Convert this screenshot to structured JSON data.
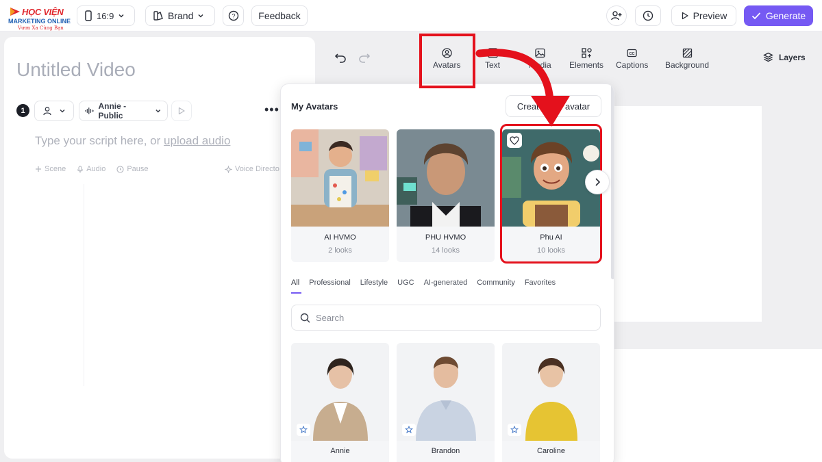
{
  "brand": {
    "line1": "HỌC VIỆN",
    "line2": "MARKETING ONLINE",
    "line3": "Vươn Xa Cùng Bạn"
  },
  "topbar": {
    "aspect_ratio": "16:9",
    "brand_label": "Brand",
    "feedback_label": "Feedback",
    "preview_label": "Preview",
    "generate_label": "Generate",
    "accent_color": "#7559f3"
  },
  "script_panel": {
    "title": "Untitled Video",
    "scene_number": "1",
    "voice": "Annie - Public",
    "placeholder": "Type your script here, or ",
    "placeholder_link": "upload audio",
    "actions": [
      "Scene",
      "Audio",
      "Pause"
    ],
    "voice_director": "Voice Directo"
  },
  "toolbar": {
    "tools": [
      {
        "label": "Avatars",
        "icon": "avatar-icon"
      },
      {
        "label": "Text",
        "icon": "text-icon"
      },
      {
        "label": "Media",
        "icon": "image-icon"
      },
      {
        "label": "Elements",
        "icon": "elements-icon"
      },
      {
        "label": "Captions",
        "icon": "captions-icon"
      },
      {
        "label": "Background",
        "icon": "background-icon"
      }
    ],
    "layers_label": "Layers"
  },
  "avatar_panel": {
    "title": "My Avatars",
    "create_label": "Create new avatar",
    "my_avatars": [
      {
        "name": "AI HVMO",
        "looks": "2 looks"
      },
      {
        "name": "PHU HVMO",
        "looks": "14 looks"
      },
      {
        "name": "Phu AI",
        "looks": "10 looks"
      }
    ],
    "tabs": [
      "All",
      "Professional",
      "Lifestyle",
      "UGC",
      "AI-generated",
      "Community",
      "Favorites"
    ],
    "active_tab": "All",
    "search_placeholder": "Search",
    "stock_avatars": [
      {
        "name": "Annie"
      },
      {
        "name": "Brandon"
      },
      {
        "name": "Caroline"
      }
    ]
  },
  "annotation_color": "#e4111c"
}
